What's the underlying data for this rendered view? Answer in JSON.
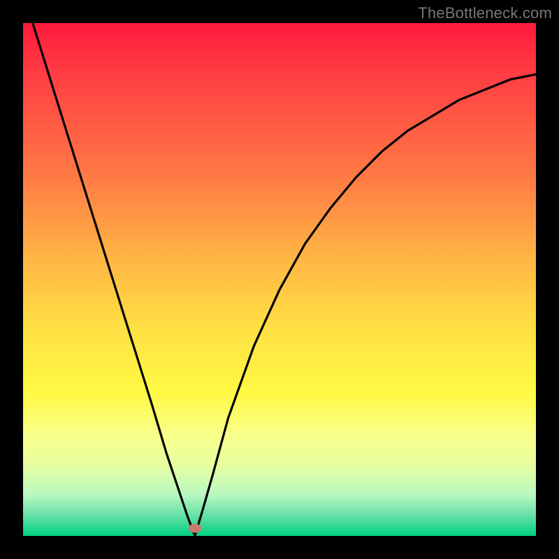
{
  "watermark_text": "TheBottleneck.com",
  "marker": {
    "x_frac": 0.335,
    "y_frac": 0.985
  },
  "chart_data": {
    "type": "line",
    "title": "",
    "xlabel": "",
    "ylabel": "",
    "xlim": [
      0,
      1
    ],
    "ylim": [
      0,
      1
    ],
    "series": [
      {
        "name": "bottleneck-curve",
        "x": [
          0.0,
          0.05,
          0.1,
          0.15,
          0.2,
          0.25,
          0.28,
          0.3,
          0.32,
          0.335,
          0.35,
          0.37,
          0.4,
          0.45,
          0.5,
          0.55,
          0.6,
          0.65,
          0.7,
          0.75,
          0.8,
          0.85,
          0.9,
          0.95,
          1.0
        ],
        "values": [
          1.06,
          0.9,
          0.74,
          0.58,
          0.42,
          0.26,
          0.16,
          0.1,
          0.04,
          0.0,
          0.05,
          0.12,
          0.23,
          0.37,
          0.48,
          0.57,
          0.64,
          0.7,
          0.75,
          0.79,
          0.82,
          0.85,
          0.87,
          0.89,
          0.9
        ]
      }
    ],
    "annotations": [
      {
        "kind": "marker",
        "x": 0.335,
        "y": 0.0,
        "color": "#c97a6e"
      }
    ],
    "background_gradient": {
      "top_color": "#ff1a3c",
      "bottom_color": "#00d080"
    }
  }
}
